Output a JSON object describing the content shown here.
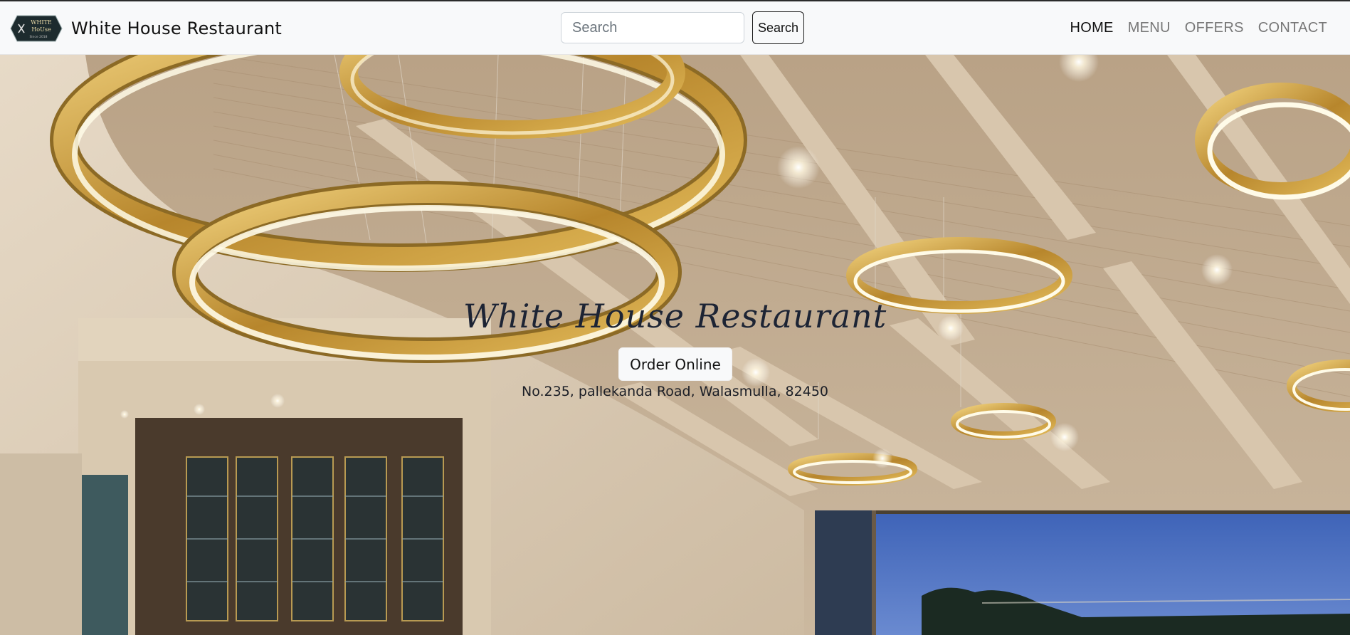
{
  "brand": {
    "name": "White House Restaurant",
    "logo_text_line1": "WHITE",
    "logo_text_line2": "HoUse",
    "logo_text_line3": "Since 2018"
  },
  "search": {
    "placeholder": "Search",
    "button_label": "Search"
  },
  "nav": {
    "items": [
      {
        "label": "HOME",
        "active": true
      },
      {
        "label": "MENU",
        "active": false
      },
      {
        "label": "OFFERS",
        "active": false
      },
      {
        "label": "CONTACT",
        "active": false
      }
    ]
  },
  "hero": {
    "title": "White House Restaurant",
    "order_button": "Order Online",
    "address": "No.235, pallekanda Road, Walasmulla, 82450"
  },
  "colors": {
    "navbar_bg": "#f8f9fa",
    "brass": "#c9a042",
    "ceiling": "#c9b59c",
    "wall": "#d8c8b2",
    "sky": "#4467b5",
    "title": "#1d2434"
  }
}
